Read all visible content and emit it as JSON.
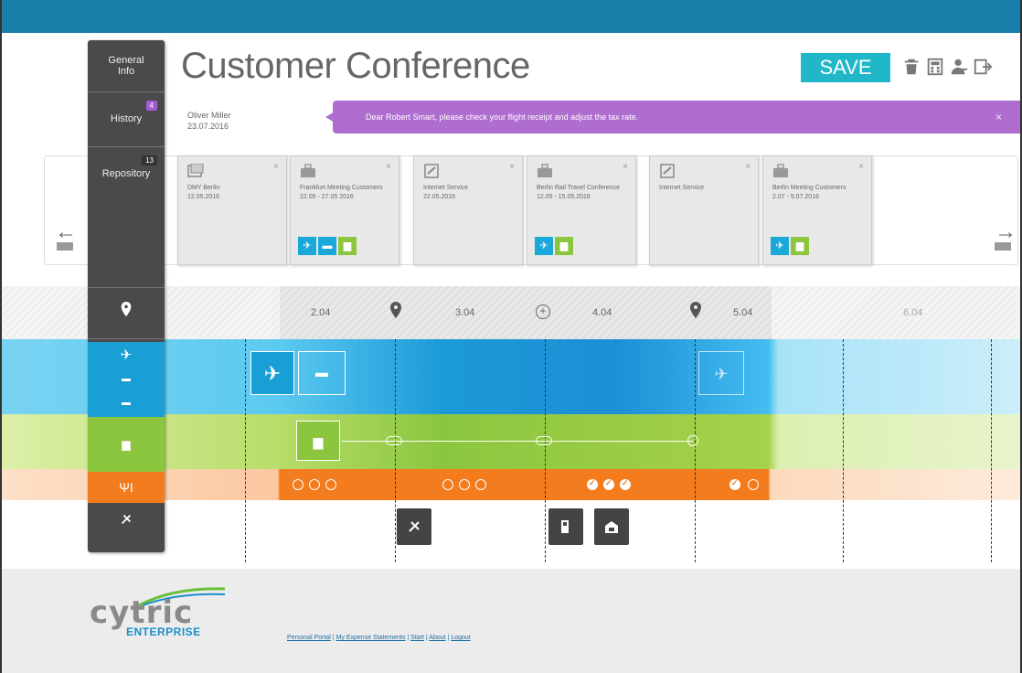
{
  "header": {
    "title": "Customer Conference",
    "save_label": "SAVE",
    "user_name": "Oliver Miller",
    "user_date": "23.07.2016"
  },
  "icons": {
    "delete": "trash-icon",
    "calculator": "calculator-icon",
    "user": "user-icon",
    "logout": "logout-icon"
  },
  "rail": {
    "general_info": "General\nInfo",
    "history": "History",
    "history_badge": "4",
    "repository": "Repository",
    "repository_badge": "13"
  },
  "notification": {
    "text": "Dear Robert Smart, please check your flight receipt and adjust the tax rate.",
    "close": "×"
  },
  "cards": [
    {
      "title": "DMY Berlin",
      "dates": "12.05.2016",
      "icon": "receipt-icon",
      "close": "×",
      "tags": []
    },
    {
      "title": "Frankfurt Meeting Customers",
      "dates": "22.05 - 27.05 2016",
      "icon": "briefcase-icon",
      "close": "×",
      "tags": [
        "plane",
        "train",
        "hotel"
      ]
    },
    {
      "title": "Internet Service",
      "dates": "22.05.2016",
      "icon": "receipt-icon",
      "close": "×",
      "tags": []
    },
    {
      "title": "Berlin Rail Travel Conference",
      "dates": "12.05 - 15.05.2016",
      "icon": "briefcase-icon",
      "close": "×",
      "tags": [
        "plane",
        "hotel"
      ]
    },
    {
      "title": "Internet Service",
      "dates": "",
      "icon": "receipt-icon",
      "close": "×",
      "tags": []
    },
    {
      "title": "Berlin Meeting Customers",
      "dates": "2.07 - 5.07.2016",
      "icon": "briefcase-icon",
      "close": "×",
      "tags": [
        "plane",
        "hotel"
      ]
    }
  ],
  "nav": {
    "prev_arrow": "←",
    "next_arrow": "→"
  },
  "timeline": {
    "dates": [
      "2.04",
      "3.04",
      "4.04",
      "5.04",
      "6.04"
    ]
  },
  "footer": {
    "logo_top": "cytric",
    "logo_bottom": "ENTERPRISE",
    "links": [
      "Personal Portal",
      "My Expense Statements",
      "Start",
      "About",
      "Logout"
    ],
    "separator": " | "
  },
  "colors": {
    "topbar": "#1a7eaa",
    "save": "#20b8c8",
    "notification": "#b06dd0",
    "blue": "#1aa8d8",
    "green": "#8cc63f",
    "orange": "#f37c1e",
    "rail": "#4a4a4a"
  }
}
